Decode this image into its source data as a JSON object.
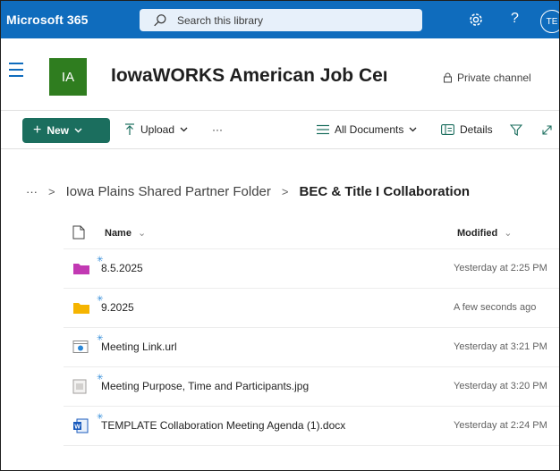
{
  "suite": {
    "brand": "Microsoft 365",
    "search_placeholder": "Search this library",
    "help": "?",
    "avatar_initials": "TE"
  },
  "site": {
    "logo_initials": "IA",
    "title": "IowaWORKS American Job Cer",
    "channel": "Private channel"
  },
  "commands": {
    "new_label": "New",
    "upload_label": "Upload",
    "more": "···",
    "view_label": "All Documents",
    "details_label": "Details"
  },
  "breadcrumb": {
    "overflow": "···",
    "parent": "Iowa Plains Shared Partner Folder",
    "current": "BEC & Title I Collaboration"
  },
  "columns": {
    "name": "Name",
    "modified": "Modified"
  },
  "files": [
    {
      "name": "8.5.2025",
      "modified": "Yesterday at 2:25 PM",
      "type": "folder",
      "color": "#c239b3"
    },
    {
      "name": "9.2025",
      "modified": "A few seconds ago",
      "type": "folder",
      "color": "#f5b400"
    },
    {
      "name": "Meeting Link.url",
      "modified": "Yesterday at 3:21 PM",
      "type": "url",
      "color": "#2b88d8"
    },
    {
      "name": "Meeting Purpose, Time and Participants.jpg",
      "modified": "Yesterday at 3:20 PM",
      "type": "image",
      "color": "#a19f9d"
    },
    {
      "name": "TEMPLATE Collaboration Meeting Agenda (1).docx",
      "modified": "Yesterday at 2:24 PM",
      "type": "word",
      "color": "#185abd"
    }
  ],
  "colors": {
    "suitebar": "#0f6cbd",
    "accent_teal": "#1b6e5e",
    "site_logo": "#2f7d1f"
  }
}
